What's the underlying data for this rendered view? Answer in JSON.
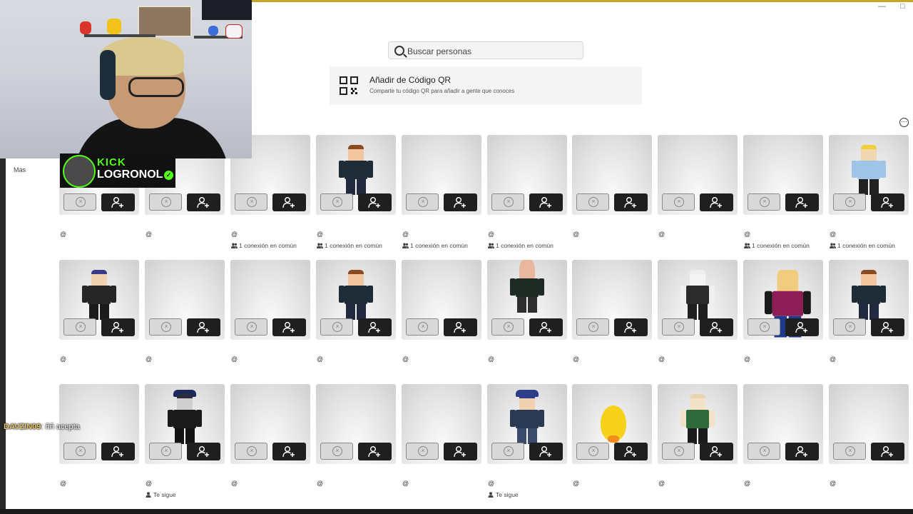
{
  "search": {
    "placeholder": "Buscar personas"
  },
  "qr_card": {
    "title": "Añadir de Código QR",
    "subtitle": "Comparte tu código QR para añadir a gente que conoces"
  },
  "sidebar": {
    "more_label": "Más"
  },
  "stream_overlay": {
    "brand": "KICK",
    "channel": "LOGRONOL",
    "chat_user": "DAVZIN09",
    "chat_message": ": ññ acepta"
  },
  "cards": [
    {
      "avatar": "none",
      "handle": "@",
      "mutual": ""
    },
    {
      "avatar": "none",
      "handle": "@",
      "mutual": ""
    },
    {
      "avatar": "none",
      "handle": "@",
      "mutual": "1 conexión en común"
    },
    {
      "avatar": "bacon-brown",
      "handle": "@",
      "mutual": "1 conexión en común"
    },
    {
      "avatar": "none",
      "handle": "@",
      "mutual": "1 conexión en común"
    },
    {
      "avatar": "none",
      "handle": "@",
      "mutual": "1 conexión en común"
    },
    {
      "avatar": "none",
      "handle": "@",
      "mutual": ""
    },
    {
      "avatar": "none",
      "handle": "@",
      "mutual": ""
    },
    {
      "avatar": "none",
      "handle": "@",
      "mutual": "1 conexión en común"
    },
    {
      "avatar": "blonde-girl",
      "handle": "@",
      "mutual": "1 conexión en común"
    },
    {
      "avatar": "dark-hoodie",
      "handle": "@",
      "mutual": ""
    },
    {
      "avatar": "none",
      "handle": "@",
      "mutual": ""
    },
    {
      "avatar": "none",
      "handle": "@",
      "mutual": ""
    },
    {
      "avatar": "bacon-brown",
      "handle": "@",
      "mutual": ""
    },
    {
      "avatar": "none",
      "handle": "@",
      "mutual": ""
    },
    {
      "avatar": "egg-head",
      "handle": "@",
      "mutual": ""
    },
    {
      "avatar": "none",
      "handle": "@",
      "mutual": ""
    },
    {
      "avatar": "white-green",
      "handle": "@",
      "mutual": ""
    },
    {
      "avatar": "barca-noob",
      "handle": "@",
      "mutual": ""
    },
    {
      "avatar": "bacon-brown",
      "handle": "@",
      "mutual": ""
    },
    {
      "avatar": "none",
      "handle": "@",
      "mutual": ""
    },
    {
      "avatar": "black-hat",
      "handle": "@",
      "mutual": "Te sigue"
    },
    {
      "avatar": "none",
      "handle": "@",
      "mutual": ""
    },
    {
      "avatar": "none",
      "handle": "@",
      "mutual": ""
    },
    {
      "avatar": "none",
      "handle": "@",
      "mutual": ""
    },
    {
      "avatar": "blue-cap",
      "handle": "@",
      "mutual": "Te sigue"
    },
    {
      "avatar": "duck",
      "handle": "@",
      "mutual": ""
    },
    {
      "avatar": "green-jersey",
      "handle": "@",
      "mutual": ""
    },
    {
      "avatar": "none",
      "handle": "@",
      "mutual": ""
    },
    {
      "avatar": "none",
      "handle": "@",
      "mutual": ""
    }
  ],
  "icons": {
    "search": "search-icon",
    "qr": "qr-code-icon",
    "more": "more-options-icon",
    "decline": "decline-circle-x-icon",
    "add": "add-friend-icon",
    "mutual": "people-icon",
    "follows": "person-icon"
  },
  "colors": {
    "kick_green": "#53fc18",
    "button_dark": "#1f1f1f",
    "accent_top": "#c8a52a"
  }
}
